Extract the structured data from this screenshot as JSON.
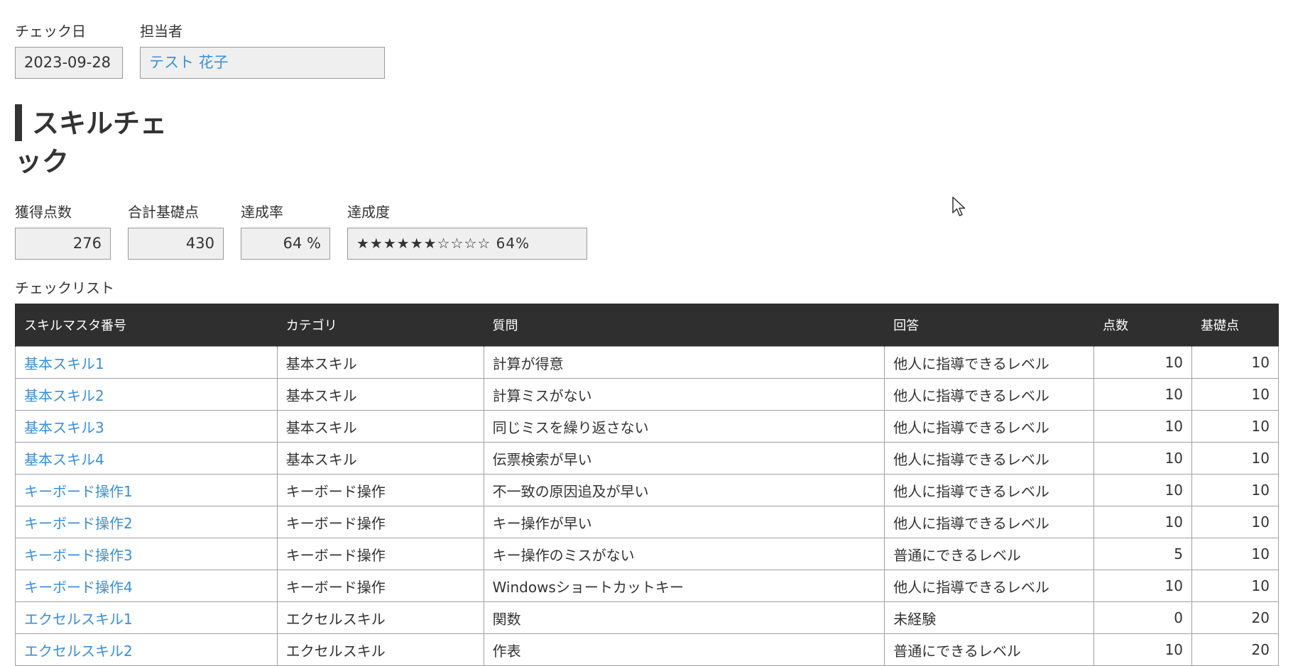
{
  "check_date": {
    "label": "チェック日",
    "value": "2023-09-28"
  },
  "person": {
    "label": "担当者",
    "value": "テスト 花子"
  },
  "heading": {
    "line1": "スキルチェ",
    "line2": "ック"
  },
  "stats": {
    "points": {
      "label": "獲得点数",
      "value": "276"
    },
    "base_total": {
      "label": "合計基礎点",
      "value": "430"
    },
    "rate": {
      "label": "達成率",
      "value": "64 %"
    },
    "degree": {
      "label": "達成度",
      "value": "★★★★★★☆☆☆☆ 64%",
      "stars_filled": 6,
      "stars_total": 10,
      "percent": 64
    }
  },
  "checklist": {
    "title": "チェックリスト",
    "headers": [
      "スキルマスタ番号",
      "カテゴリ",
      "質問",
      "回答",
      "点数",
      "基礎点"
    ],
    "rows": [
      [
        "基本スキル1",
        "基本スキル",
        "計算が得意",
        "他人に指導できるレベル",
        "10",
        "10"
      ],
      [
        "基本スキル2",
        "基本スキル",
        "計算ミスがない",
        "他人に指導できるレベル",
        "10",
        "10"
      ],
      [
        "基本スキル3",
        "基本スキル",
        "同じミスを繰り返さない",
        "他人に指導できるレベル",
        "10",
        "10"
      ],
      [
        "基本スキル4",
        "基本スキル",
        "伝票検索が早い",
        "他人に指導できるレベル",
        "10",
        "10"
      ],
      [
        "キーボード操作1",
        "キーボード操作",
        "不一致の原因追及が早い",
        "他人に指導できるレベル",
        "10",
        "10"
      ],
      [
        "キーボード操作2",
        "キーボード操作",
        "キー操作が早い",
        "他人に指導できるレベル",
        "10",
        "10"
      ],
      [
        "キーボード操作3",
        "キーボード操作",
        "キー操作のミスがない",
        "普通にできるレベル",
        "5",
        "10"
      ],
      [
        "キーボード操作4",
        "キーボード操作",
        "Windowsショートカットキー",
        "他人に指導できるレベル",
        "10",
        "10"
      ],
      [
        "エクセルスキル1",
        "エクセルスキル",
        "関数",
        "未経験",
        "0",
        "20"
      ],
      [
        "エクセルスキル2",
        "エクセルスキル",
        "作表",
        "普通にできるレベル",
        "10",
        "20"
      ]
    ]
  },
  "colors": {
    "link": "#3b8fd6",
    "header_bg": "#2f2f2f",
    "field_bg": "#efefef"
  },
  "icons": {
    "cursor": "mouse-pointer-icon"
  }
}
